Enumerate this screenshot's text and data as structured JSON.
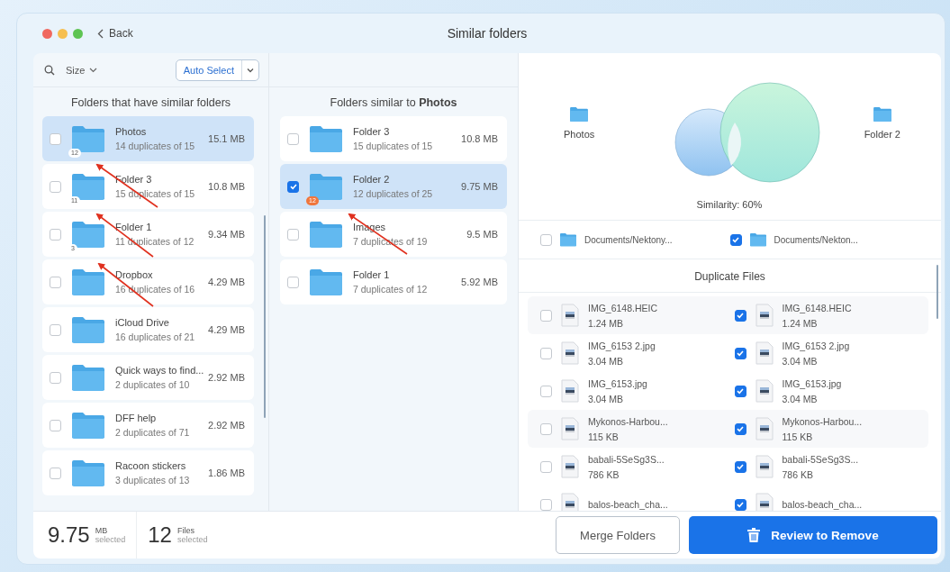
{
  "window": {
    "title": "Similar folders",
    "back": "Back"
  },
  "toolbar": {
    "sort": "Size",
    "auto_select": "Auto Select"
  },
  "left_panel": {
    "heading": "Folders that have similar folders",
    "items": [
      {
        "name": "Photos",
        "detail": "14 duplicates of 15",
        "size": "15.1 MB",
        "badge": {
          "text": "12",
          "color": "#ffffff"
        },
        "checked": false,
        "selected": true
      },
      {
        "name": "Folder 3",
        "detail": "15 duplicates of 15",
        "size": "10.8 MB",
        "badge": {
          "text": "11",
          "color": "#ffffff"
        },
        "checked": false,
        "selected": false
      },
      {
        "name": "Folder 1",
        "detail": "11 duplicates of 12",
        "size": "9.34 MB",
        "badge": {
          "text": "3",
          "color": "#ffffff"
        },
        "checked": false,
        "selected": false
      },
      {
        "name": "Dropbox",
        "detail": "16 duplicates of 16",
        "size": "4.29 MB",
        "checked": false,
        "selected": false
      },
      {
        "name": "iCloud Drive",
        "detail": "16 duplicates of 21",
        "size": "4.29 MB",
        "checked": false,
        "selected": false
      },
      {
        "name": "Quick ways to find...",
        "detail": "2 duplicates of 10",
        "size": "2.92 MB",
        "checked": false,
        "selected": false
      },
      {
        "name": "DFF help",
        "detail": "2 duplicates of 71",
        "size": "2.92 MB",
        "checked": false,
        "selected": false
      },
      {
        "name": "Racoon stickers",
        "detail": "3 duplicates of 13",
        "size": "1.86 MB",
        "checked": false,
        "selected": false
      }
    ]
  },
  "middle_panel": {
    "heading": "Folders similar to **Photos**",
    "items": [
      {
        "name": "Folder 3",
        "detail": "15 duplicates of 15",
        "size": "10.8 MB",
        "checked": false,
        "selected": false
      },
      {
        "name": "Folder 2",
        "detail": "12 duplicates of 25",
        "size": "9.75 MB",
        "badge": {
          "text": "12",
          "color": "#f0763c"
        },
        "checked": true,
        "selected": true
      },
      {
        "name": "Images",
        "detail": "7 duplicates of 19",
        "size": "9.5 MB",
        "checked": false,
        "selected": false
      },
      {
        "name": "Folder 1",
        "detail": "7 duplicates of 12",
        "size": "5.92 MB",
        "checked": false,
        "selected": false
      }
    ]
  },
  "comparison": {
    "left_name": "Photos",
    "right_name": "Folder 2",
    "similarity": "Similarity: 60%",
    "paths": [
      {
        "path": "Documents/Nektony...",
        "checked": false
      },
      {
        "path": "Documents/Nekton...",
        "checked": true
      }
    ]
  },
  "duplicate_files": {
    "heading": "Duplicate Files",
    "rows": [
      {
        "left": {
          "name": "IMG_6148.HEIC",
          "size": "1.24 MB",
          "checked": false
        },
        "right": {
          "name": "IMG_6148.HEIC",
          "size": "1.24 MB",
          "checked": true
        }
      },
      {
        "left": {
          "name": "IMG_6153 2.jpg",
          "size": "3.04 MB",
          "checked": false
        },
        "right": {
          "name": "IMG_6153 2.jpg",
          "size": "3.04 MB",
          "checked": true
        }
      },
      {
        "left": {
          "name": "IMG_6153.jpg",
          "size": "3.04 MB",
          "checked": false
        },
        "right": {
          "name": "IMG_6153.jpg",
          "size": "3.04 MB",
          "checked": true
        }
      },
      {
        "left": {
          "name": "Mykonos-Harbou...",
          "size": "115 KB",
          "checked": false
        },
        "right": {
          "name": "Mykonos-Harbou...",
          "size": "115 KB",
          "checked": true
        }
      },
      {
        "left": {
          "name": "babali-5SeSg3S...",
          "size": "786 KB",
          "checked": false
        },
        "right": {
          "name": "babali-5SeSg3S...",
          "size": "786 KB",
          "checked": true
        }
      },
      {
        "left": {
          "name": "balos-beach_cha...",
          "checked": false
        },
        "right": {
          "name": "balos-beach_cha...",
          "checked": true
        }
      }
    ]
  },
  "footer": {
    "size_value": "9.75",
    "size_unit": "MB",
    "size_label": "selected",
    "files_value": "12",
    "files_unit": "Files",
    "files_label": "selected",
    "merge_button": "Merge Folders",
    "remove_button": "Review to Remove"
  }
}
